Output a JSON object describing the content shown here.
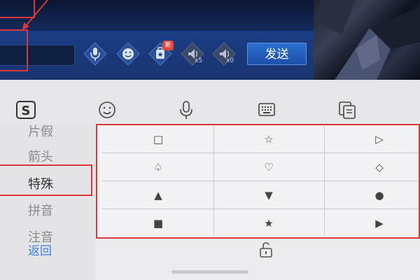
{
  "game": {
    "send_label": "发送",
    "new_badge": "新",
    "counts": [
      "x5",
      "x0"
    ]
  },
  "toolbar": {
    "items": [
      "sogou-logo",
      "emoji-icon",
      "microphone-icon",
      "keyboard-icon",
      "clipboard-icon"
    ]
  },
  "categories": [
    {
      "label": "片假",
      "active": false
    },
    {
      "label": "箭头",
      "active": false
    },
    {
      "label": "特殊",
      "active": true
    },
    {
      "label": "拼音",
      "active": false
    },
    {
      "label": "注音",
      "active": false
    }
  ],
  "back_label": "返回",
  "symbols": [
    [
      "□",
      "☆",
      "▷"
    ],
    [
      "♤",
      "♡",
      "◇"
    ],
    [
      "▲",
      "▼",
      "●"
    ],
    [
      "■",
      "★",
      "▶"
    ]
  ],
  "colors": {
    "highlight": "#d9383a",
    "link": "#3f7de0",
    "send_button": "#2b6fd0"
  }
}
